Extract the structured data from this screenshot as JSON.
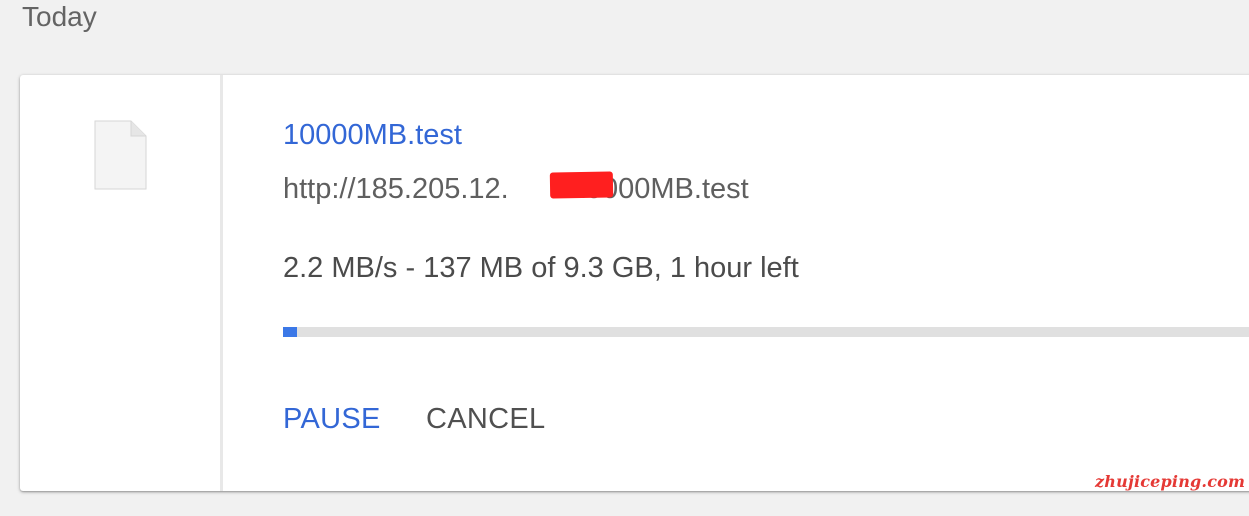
{
  "section": {
    "title": "Today"
  },
  "download": {
    "file_name": "10000MB.test",
    "url_prefix": "http://185.205.12.",
    "url_suffix": "10000MB.test",
    "status": "2.2 MB/s - 137 MB of 9.3 GB, 1 hour left",
    "progress_fraction": 0.0144,
    "icon": "file-icon",
    "redaction_color": "#ff1f1f"
  },
  "actions": {
    "pause_label": "PAUSE",
    "cancel_label": "CANCEL"
  },
  "colors": {
    "accent": "#3367d6",
    "progress": "#3b78e7",
    "track": "#e0e0e0"
  },
  "watermark": {
    "text": "zhujiceping.com"
  }
}
